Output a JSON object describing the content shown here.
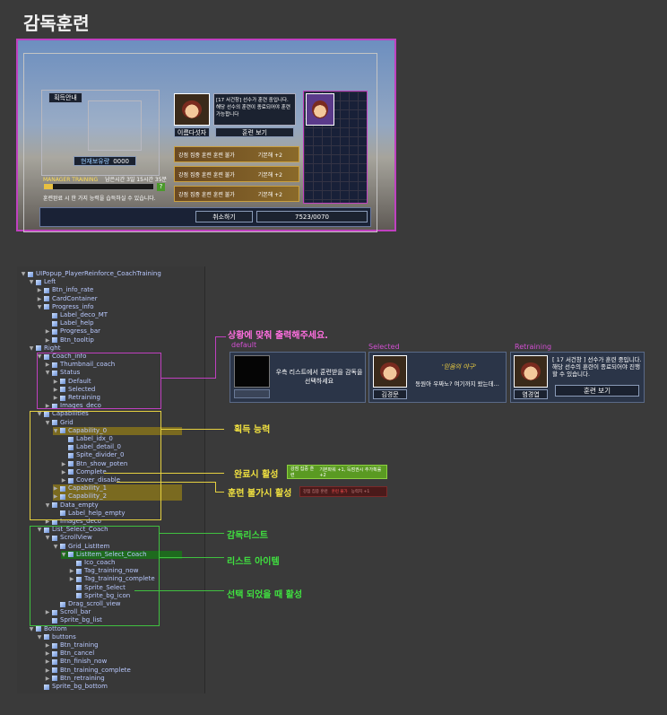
{
  "title": "감독훈련",
  "scene": {
    "info_button": "획득안내",
    "manager_name_btn": "이름다섯자",
    "coach_text": "[17 서건창] 선수가 훈련 중입니다. 해당 선수의 훈련이 종료되어야 훈련 가능합니다",
    "training_view_btn": "훈련 보기",
    "cost_label": "현재보유량",
    "cost_value": "0000",
    "manager_training": "MANAGER TRAINING",
    "remaining_time": "남은시간 3일 15시간 35분",
    "hint": "훈련완료 시 한 가지 능력을 습득하실 수 있습니다.",
    "capability_rows": [
      "강점 집중 훈련 훈련 불가",
      "강점 집중 훈련 훈련 불가",
      "강점 집중 훈련 훈련 불가"
    ],
    "capability_detail": "기본해 +2",
    "cancel_btn": "취소하기",
    "training_btn": "7523/0070"
  },
  "hierarchy": [
    {
      "label": "UIPopup_PlayerReinforce_CoachTraining",
      "indent": 0,
      "open": true
    },
    {
      "label": "Left",
      "indent": 1,
      "open": true
    },
    {
      "label": "Btn_info_rate",
      "indent": 2,
      "open": false
    },
    {
      "label": "CardContainer",
      "indent": 2,
      "open": false
    },
    {
      "label": "Progress_info",
      "indent": 2,
      "open": true
    },
    {
      "label": "Label_deco_MT",
      "indent": 3,
      "open": null
    },
    {
      "label": "Label_help",
      "indent": 3,
      "open": null
    },
    {
      "label": "Progress_bar",
      "indent": 3,
      "open": false
    },
    {
      "label": "Btn_tooltip",
      "indent": 3,
      "open": false
    },
    {
      "label": "Right",
      "indent": 1,
      "open": true
    },
    {
      "label": "Coach_info",
      "indent": 2,
      "open": true
    },
    {
      "label": "Thumbnail_coach",
      "indent": 3,
      "open": false
    },
    {
      "label": "Status",
      "indent": 3,
      "open": true
    },
    {
      "label": "Default",
      "indent": 4,
      "open": false
    },
    {
      "label": "Selected",
      "indent": 4,
      "open": false
    },
    {
      "label": "Retraining",
      "indent": 4,
      "open": false
    },
    {
      "label": "Images_deco",
      "indent": 3,
      "open": false
    },
    {
      "label": "Capabilities",
      "indent": 2,
      "open": true
    },
    {
      "label": "Grid",
      "indent": 3,
      "open": true
    },
    {
      "label": "Capability_0",
      "indent": 4,
      "open": true,
      "hl": "yellow"
    },
    {
      "label": "Label_idx_0",
      "indent": 5,
      "open": null
    },
    {
      "label": "Label_detail_0",
      "indent": 5,
      "open": null
    },
    {
      "label": "Spite_divider_0",
      "indent": 5,
      "open": null
    },
    {
      "label": "Btn_show_poten",
      "indent": 5,
      "open": false
    },
    {
      "label": "Complete",
      "indent": 5,
      "open": false
    },
    {
      "label": "Cover_disable",
      "indent": 5,
      "open": false
    },
    {
      "label": "Capability_1",
      "indent": 4,
      "open": false,
      "hl": "yellow"
    },
    {
      "label": "Capability_2",
      "indent": 4,
      "open": false,
      "hl": "yellow"
    },
    {
      "label": "Data_empty",
      "indent": 3,
      "open": true
    },
    {
      "label": "Label_help_empty",
      "indent": 4,
      "open": null
    },
    {
      "label": "Images_deco",
      "indent": 3,
      "open": false
    },
    {
      "label": "List_Select_Coach",
      "indent": 2,
      "open": true
    },
    {
      "label": "ScrollView",
      "indent": 3,
      "open": true
    },
    {
      "label": "Grid_ListItem",
      "indent": 4,
      "open": true
    },
    {
      "label": "ListItem_Select_Coach",
      "indent": 5,
      "open": true,
      "hl": "green"
    },
    {
      "label": "Ico_coach",
      "indent": 6,
      "open": null
    },
    {
      "label": "Tag_training_now",
      "indent": 6,
      "open": false
    },
    {
      "label": "Tag_training_complete",
      "indent": 6,
      "open": false
    },
    {
      "label": "Sprite_Select",
      "indent": 6,
      "open": null
    },
    {
      "label": "Sprite_bg_icon",
      "indent": 6,
      "open": null
    },
    {
      "label": "Drag_scroll_view",
      "indent": 4,
      "open": null
    },
    {
      "label": "Scroll_bar",
      "indent": 3,
      "open": false
    },
    {
      "label": "Sprite_bg_list",
      "indent": 3,
      "open": null
    },
    {
      "label": "Bottom",
      "indent": 1,
      "open": true
    },
    {
      "label": "buttons",
      "indent": 2,
      "open": true
    },
    {
      "label": "Btn_training",
      "indent": 3,
      "open": false
    },
    {
      "label": "Btn_cancel",
      "indent": 3,
      "open": false
    },
    {
      "label": "Btn_finish_now",
      "indent": 3,
      "open": false
    },
    {
      "label": "Btn_training_complete",
      "indent": 3,
      "open": false
    },
    {
      "label": "Btn_retraining",
      "indent": 3,
      "open": false
    },
    {
      "label": "Sprite_bg_bottom",
      "indent": 2,
      "open": null
    }
  ],
  "annotations": {
    "status_note": "상황에 맞춰 출력해주세요.",
    "tab_default": "default",
    "tab_selected": "Selected",
    "tab_retraining": "Retraining",
    "default_text": "우측 리스트에서 훈련받을 감독을 선택하세요",
    "selected_quote": "'믿음의 야구'",
    "selected_text": "동원아 우짜노? 여기까지 왔는데...",
    "selected_name": "김경문",
    "retrain_text": "[ 17 서건창 ] 선수가 훈련 중입니다. 해당 선수의 훈련이 종료되어야 진행할 수 있습니다.",
    "retrain_name": "염경엽",
    "retrain_btn": "훈련 보기",
    "acquire_ability": "획득 능력",
    "complete_active": "완료시 활성",
    "complete_sample_a": "강점 집중 훈련",
    "complete_sample_b": "기본파워 +1, 득점권시 추가획률 +2",
    "disable_active": "훈련 불가시 활성",
    "disable_sample_a": "강점 집중 훈련",
    "disable_sample_b": "훈련 불가",
    "disable_sample_c": "능력치 +1",
    "coach_list": "감독리스트",
    "list_item": "리스트 아이템",
    "selected_active": "선택 되었을 때 활성"
  },
  "colors": {
    "magenta": "#c040c0",
    "yellow": "#e5d040",
    "green": "#40c040"
  }
}
